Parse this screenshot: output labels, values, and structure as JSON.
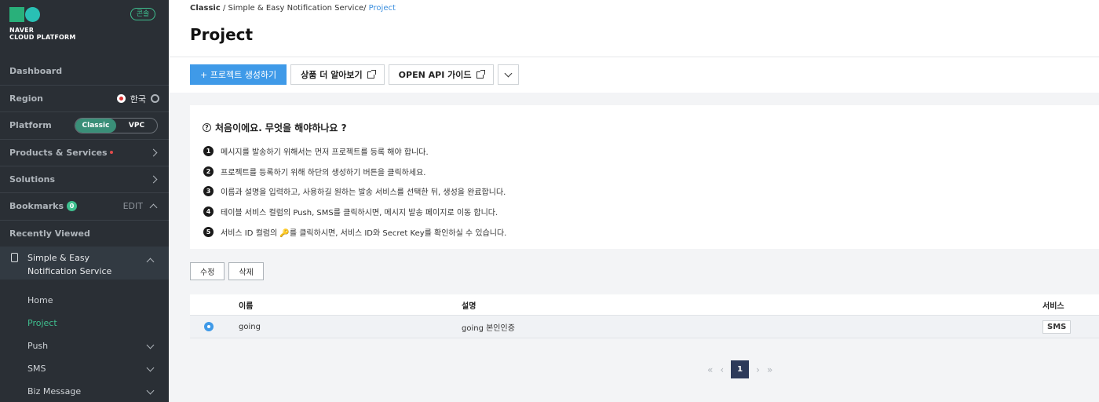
{
  "brand": {
    "logo_text_1": "NAVER",
    "logo_text_2": "CLOUD PLATFORM",
    "console_badge": "콘솔",
    "colors": {
      "green": "#29b07a",
      "teal": "#29c0b4"
    }
  },
  "sidebar": {
    "dashboard": "Dashboard",
    "region_label": "Region",
    "region_value": "한국",
    "platform_label": "Platform",
    "platform_options": [
      "Classic",
      "VPC"
    ],
    "platform_selected": "Classic",
    "products": "Products & Services",
    "solutions": "Solutions",
    "bookmarks": "Bookmarks",
    "bookmarks_count": "0",
    "bookmarks_edit": "EDIT",
    "recently_viewed": "Recently Viewed",
    "service_name": "Simple & Easy Notification Service",
    "sub_items": [
      {
        "label": "Home",
        "active": false,
        "expandable": false
      },
      {
        "label": "Project",
        "active": true,
        "expandable": false
      },
      {
        "label": "Push",
        "active": false,
        "expandable": true
      },
      {
        "label": "SMS",
        "active": false,
        "expandable": true
      },
      {
        "label": "Biz Message",
        "active": false,
        "expandable": true
      }
    ]
  },
  "breadcrumb": {
    "root": "Classic",
    "sep": "/",
    "service": "Simple & Easy Notification Service",
    "current": "Project"
  },
  "page": {
    "title": "Project"
  },
  "toolbar": {
    "create": "+ 프로젝트 생성하기",
    "learn_more": "상품 더 알아보기",
    "api_guide": "OPEN API 가이드"
  },
  "guide": {
    "title": "처음이에요. 무엇을 해야하나요 ?",
    "steps": [
      "메시지를 발송하기 위해서는 먼저 프로젝트를 등록 해야 합니다.",
      "프로젝트를 등록하기 위해 하단의 생성하기 버튼을 클릭하세요.",
      "이름과 설명을 입력하고, 사용하길 원하는 발송 서비스를 선택한 뒤, 생성을 완료합니다.",
      "테이블 서비스 컬럼의 Push, SMS를 클릭하시면, 메시지 발송 페이지로 이동 합니다.",
      "서비스 ID 컬럼의 🔑를 클릭하시면, 서비스 ID와 Secret Key를 확인하실 수 있습니다."
    ]
  },
  "actions": {
    "edit": "수정",
    "delete": "삭제"
  },
  "table": {
    "columns": [
      "이름",
      "설명",
      "서비스"
    ],
    "rows": [
      {
        "name": "going",
        "description": "going 본인인증",
        "service": "SMS",
        "selected": true
      }
    ]
  },
  "pagination": {
    "current": "1",
    "first": "«",
    "prev": "‹",
    "next": "›",
    "last": "»"
  }
}
